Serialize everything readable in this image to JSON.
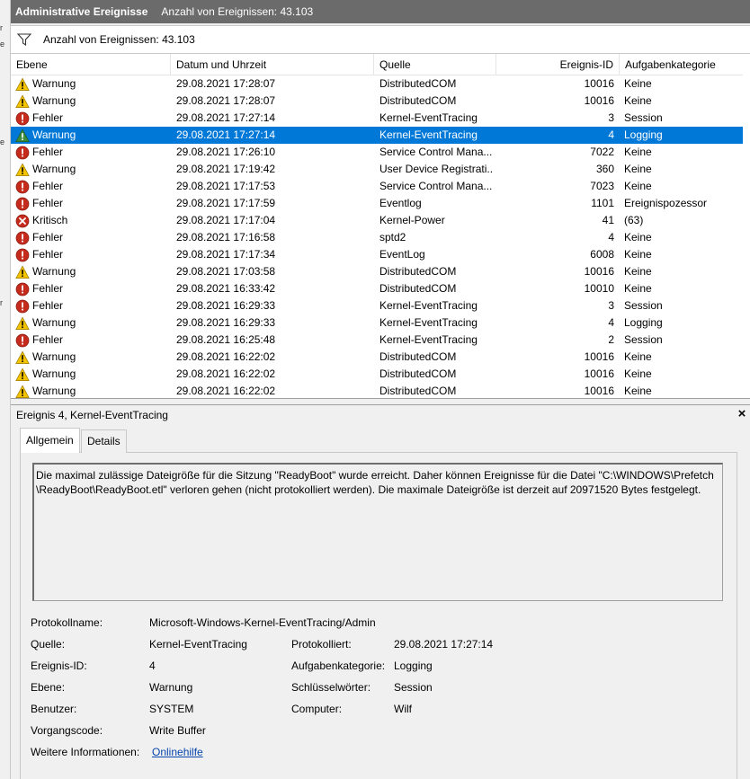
{
  "left_strip": [
    "r",
    "e",
    "e",
    "r"
  ],
  "titlebar": {
    "title": "Administrative Ereignisse",
    "subtitle": "Anzahl von Ereignissen: 43.103"
  },
  "filter": {
    "icon": "filter-icon",
    "text": "Anzahl von Ereignissen: 43.103"
  },
  "table": {
    "columns": [
      "Ebene",
      "Datum und Uhrzeit",
      "Quelle",
      "Ereignis-ID",
      "Aufgabenkategorie"
    ],
    "rows": [
      {
        "level": "Warnung",
        "icon": "warning-icon",
        "date": "29.08.2021 17:28:07",
        "source": "DistributedCOM",
        "id": "10016",
        "category": "Keine"
      },
      {
        "level": "Warnung",
        "icon": "warning-icon",
        "date": "29.08.2021 17:28:07",
        "source": "DistributedCOM",
        "id": "10016",
        "category": "Keine"
      },
      {
        "level": "Fehler",
        "icon": "error-icon",
        "date": "29.08.2021 17:27:14",
        "source": "Kernel-EventTracing",
        "id": "3",
        "category": "Session"
      },
      {
        "level": "Warnung",
        "icon": "warning-icon",
        "date": "29.08.2021 17:27:14",
        "source": "Kernel-EventTracing",
        "id": "4",
        "category": "Logging",
        "selected": true
      },
      {
        "level": "Fehler",
        "icon": "error-icon",
        "date": "29.08.2021 17:26:10",
        "source": "Service Control Mana...",
        "id": "7022",
        "category": "Keine"
      },
      {
        "level": "Warnung",
        "icon": "warning-icon",
        "date": "29.08.2021 17:19:42",
        "source": "User Device Registrati...",
        "id": "360",
        "category": "Keine"
      },
      {
        "level": "Fehler",
        "icon": "error-icon",
        "date": "29.08.2021 17:17:53",
        "source": "Service Control Mana...",
        "id": "7023",
        "category": "Keine"
      },
      {
        "level": "Fehler",
        "icon": "error-icon",
        "date": "29.08.2021 17:17:59",
        "source": "Eventlog",
        "id": "1101",
        "category": "Ereignispozessor"
      },
      {
        "level": "Kritisch",
        "icon": "critical-icon",
        "date": "29.08.2021 17:17:04",
        "source": "Kernel-Power",
        "id": "41",
        "category": "(63)"
      },
      {
        "level": "Fehler",
        "icon": "error-icon",
        "date": "29.08.2021 17:16:58",
        "source": "sptd2",
        "id": "4",
        "category": "Keine"
      },
      {
        "level": "Fehler",
        "icon": "error-icon",
        "date": "29.08.2021 17:17:34",
        "source": "EventLog",
        "id": "6008",
        "category": "Keine"
      },
      {
        "level": "Warnung",
        "icon": "warning-icon",
        "date": "29.08.2021 17:03:58",
        "source": "DistributedCOM",
        "id": "10016",
        "category": "Keine"
      },
      {
        "level": "Fehler",
        "icon": "error-icon",
        "date": "29.08.2021 16:33:42",
        "source": "DistributedCOM",
        "id": "10010",
        "category": "Keine"
      },
      {
        "level": "Fehler",
        "icon": "error-icon",
        "date": "29.08.2021 16:29:33",
        "source": "Kernel-EventTracing",
        "id": "3",
        "category": "Session"
      },
      {
        "level": "Warnung",
        "icon": "warning-icon",
        "date": "29.08.2021 16:29:33",
        "source": "Kernel-EventTracing",
        "id": "4",
        "category": "Logging"
      },
      {
        "level": "Fehler",
        "icon": "error-icon",
        "date": "29.08.2021 16:25:48",
        "source": "Kernel-EventTracing",
        "id": "2",
        "category": "Session"
      },
      {
        "level": "Warnung",
        "icon": "warning-icon",
        "date": "29.08.2021 16:22:02",
        "source": "DistributedCOM",
        "id": "10016",
        "category": "Keine"
      },
      {
        "level": "Warnung",
        "icon": "warning-icon",
        "date": "29.08.2021 16:22:02",
        "source": "DistributedCOM",
        "id": "10016",
        "category": "Keine"
      },
      {
        "level": "Warnung",
        "icon": "warning-icon",
        "date": "29.08.2021 16:22:02",
        "source": "DistributedCOM",
        "id": "10016",
        "category": "Keine"
      }
    ]
  },
  "detail": {
    "title": "Ereignis 4, Kernel-EventTracing",
    "close": "×",
    "tabs": [
      "Allgemein",
      "Details"
    ],
    "description_line1": "Die maximal zulässige Dateigröße für die Sitzung \"ReadyBoot\" wurde erreicht. Daher können Ereignisse für die Datei \"C:\\WINDOWS\\Prefetch",
    "description_line2": "\\ReadyBoot\\ReadyBoot.etl\" verloren gehen (nicht protokolliert werden). Die maximale Dateigröße ist derzeit auf 20971520 Bytes festgelegt.",
    "props": {
      "log_name_label": "Protokollname:",
      "log_name": "Microsoft-Windows-Kernel-EventTracing/Admin",
      "source_label": "Quelle:",
      "source": "Kernel-EventTracing",
      "logged_label": "Protokolliert:",
      "logged": "29.08.2021 17:27:14",
      "event_id_label": "Ereignis-ID:",
      "event_id": "4",
      "task_label": "Aufgabenkategorie:",
      "task": "Logging",
      "level_label": "Ebene:",
      "level": "Warnung",
      "keywords_label": "Schlüsselwörter:",
      "keywords": "Session",
      "user_label": "Benutzer:",
      "user": "SYSTEM",
      "computer_label": "Computer:",
      "computer": "Wilf",
      "opcode_label": "Vorgangscode:",
      "opcode": "Write Buffer",
      "more_label": "Weitere Informationen:",
      "more_link": "Onlinehilfe"
    }
  },
  "colors": {
    "selection": "#0078d7",
    "titlebar": "#6b6b6b",
    "warning": "#f4c300",
    "error": "#c42b1c"
  }
}
